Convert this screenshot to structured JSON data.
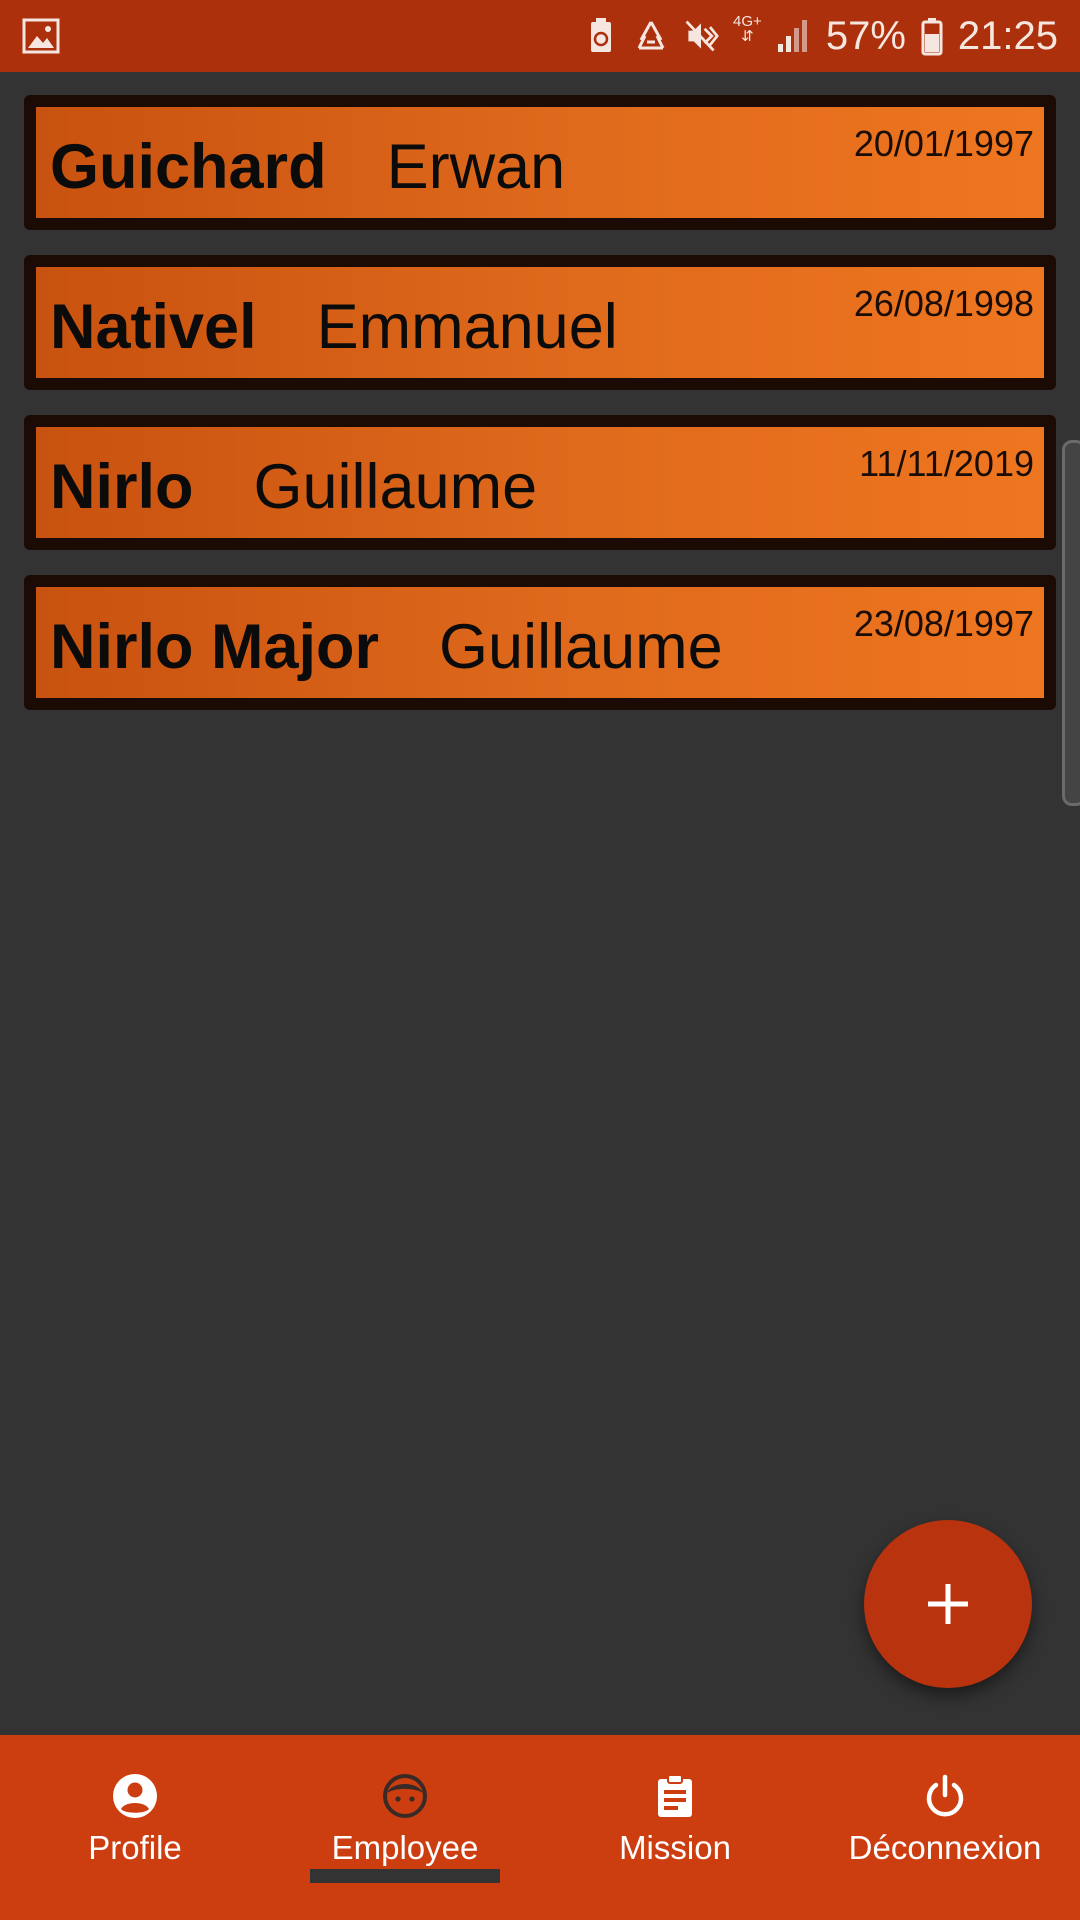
{
  "status_bar": {
    "battery_percent": "57%",
    "time": "21:25",
    "network_type": "4G+",
    "icons": [
      "gallery-icon",
      "battery-saver-icon",
      "recycle-icon",
      "vibrate-mute-icon",
      "network-4g-icon",
      "signal-icon",
      "battery-icon"
    ]
  },
  "employees": [
    {
      "last_name": "Guichard",
      "first_name": "Erwan",
      "date": "20/01/1997"
    },
    {
      "last_name": "Nativel",
      "first_name": "Emmanuel",
      "date": "26/08/1998"
    },
    {
      "last_name": "Nirlo",
      "first_name": "Guillaume",
      "date": "11/11/2019"
    },
    {
      "last_name": "Nirlo Major",
      "first_name": "Guillaume",
      "date": "23/08/1997"
    }
  ],
  "fab": {
    "icon": "plus-icon"
  },
  "bottom_nav": {
    "active": "Employee",
    "items": [
      {
        "label": "Profile",
        "icon": "account-circle-icon"
      },
      {
        "label": "Employee",
        "icon": "face-icon"
      },
      {
        "label": "Mission",
        "icon": "clipboard-icon"
      },
      {
        "label": "Déconnexion",
        "icon": "power-icon"
      }
    ]
  },
  "colors": {
    "status_bar": "#ad300c",
    "background": "#333333",
    "card_gradient_start": "#c8520f",
    "card_gradient_end": "#ef7620",
    "card_border": "#1c0a04",
    "fab": "#b8330e",
    "bottom_nav": "#cc3e10"
  }
}
